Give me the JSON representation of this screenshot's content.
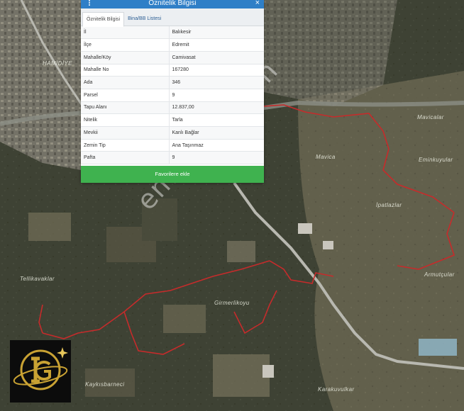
{
  "panel": {
    "title": "Öznitelik Bilgisi",
    "close_label": "×",
    "tabs": [
      {
        "label": "Öznitelik Bilgisi",
        "active": true
      },
      {
        "label": "Bina/BB Listesi",
        "active": false
      }
    ],
    "rows": [
      {
        "key": "İl",
        "value": "Balıkesir"
      },
      {
        "key": "İlçe",
        "value": "Edremit"
      },
      {
        "key": "Mahalle/Köy",
        "value": "Camivasat"
      },
      {
        "key": "Mahalle No",
        "value": "167280"
      },
      {
        "key": "Ada",
        "value": "346"
      },
      {
        "key": "Parsel",
        "value": "9"
      },
      {
        "key": "Tapu Alanı",
        "value": "12.837,00"
      },
      {
        "key": "Nitelik",
        "value": "Tarla"
      },
      {
        "key": "Mevkii",
        "value": "Kanlı Bağlar"
      },
      {
        "key": "Zemin Tip",
        "value": "Ana Taşınmaz"
      },
      {
        "key": "Pafta",
        "value": "9"
      }
    ],
    "favorite_button_label": "Favorilere ekle",
    "colors": {
      "header": "#2f7fc7",
      "button": "#3fb24f"
    }
  },
  "map": {
    "place_labels": {
      "hamidiye": "HAMİDİYE",
      "mavicalar": "Mavicalar",
      "emin_kuyular": "Eminkuyular",
      "mavica": "Mavica",
      "ipatlazlar": "İpatlazlar",
      "tellikavaklar": "Tellikavaklar",
      "armutcular": "Armutçular",
      "girmerlikoyu": "Girmerlikoyu",
      "karakuvulkar": "Karakuvulkar",
      "kaykisbarneci": "Kaykısbarneci"
    },
    "boundary_color": "#c62b2b",
    "road_color": "#b8b8b0"
  },
  "watermark": "emlakjet.com",
  "logo": {
    "letters": "IG",
    "icon": "globe-star-logo"
  }
}
